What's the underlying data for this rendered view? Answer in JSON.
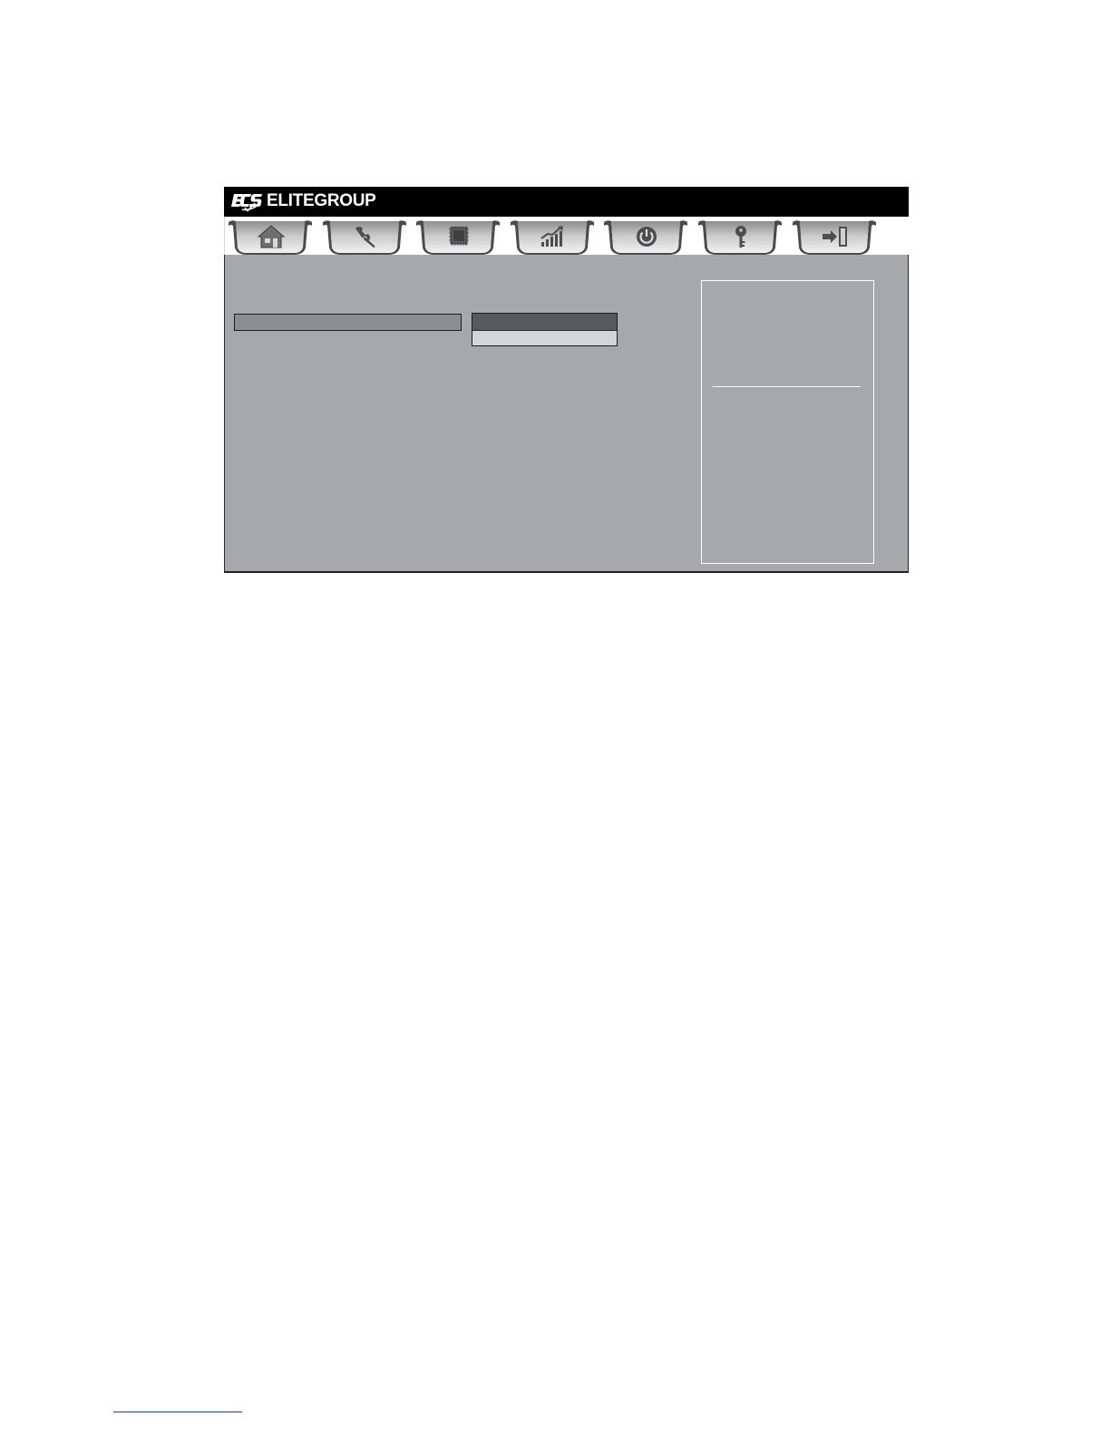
{
  "brand": {
    "logo": "ECS",
    "name": "ELITEGROUP"
  },
  "tabs": [
    {
      "id": "main",
      "icon": "house-icon"
    },
    {
      "id": "advanced",
      "icon": "wrench-icon"
    },
    {
      "id": "chipset",
      "icon": "chip-icon"
    },
    {
      "id": "mis",
      "icon": "chart-icon"
    },
    {
      "id": "boot",
      "icon": "power-icon"
    },
    {
      "id": "security",
      "icon": "key-icon"
    },
    {
      "id": "exit",
      "icon": "exit-icon"
    }
  ],
  "colors": {
    "panel": "#a7a8ab",
    "highlight": "#58595b",
    "option": "#d4d5d7"
  }
}
